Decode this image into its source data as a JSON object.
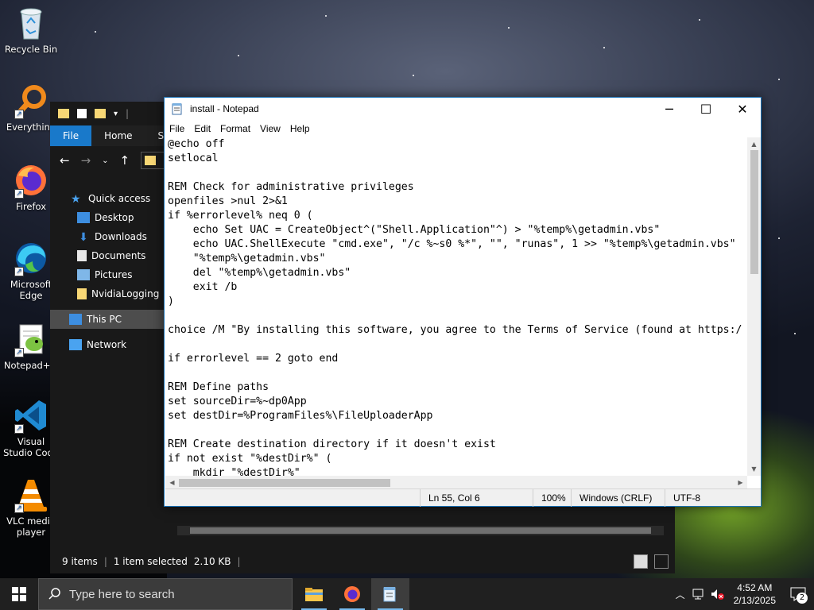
{
  "desktop": {
    "icons": [
      {
        "label": "Recycle Bin",
        "icon": "recycle-bin-icon"
      },
      {
        "label": "Everything",
        "icon": "everything-search-icon"
      },
      {
        "label": "Firefox",
        "icon": "firefox-icon"
      },
      {
        "label": "Microsoft Edge",
        "icon": "edge-icon"
      },
      {
        "label": "Notepad++",
        "icon": "notepadpp-icon"
      },
      {
        "label": "Visual Studio Code",
        "icon": "vscode-icon"
      },
      {
        "label": "VLC media player",
        "icon": "vlc-icon"
      }
    ]
  },
  "explorer": {
    "ribbon_tabs": [
      "File",
      "Home",
      "Sh"
    ],
    "sidebar": [
      {
        "label": "Quick access",
        "icon": "star-icon"
      },
      {
        "label": "Desktop",
        "icon": "desktop-folder-icon"
      },
      {
        "label": "Downloads",
        "icon": "download-icon"
      },
      {
        "label": "Documents",
        "icon": "documents-icon"
      },
      {
        "label": "Pictures",
        "icon": "pictures-icon"
      },
      {
        "label": "NvidiaLogging",
        "icon": "folder-icon"
      },
      {
        "label": "This PC",
        "icon": "pc-icon"
      },
      {
        "label": "Network",
        "icon": "network-icon"
      }
    ],
    "status": {
      "items": "9 items",
      "selected": "1 item selected",
      "size": "2.10 KB"
    }
  },
  "notepad": {
    "title": "install - Notepad",
    "menu": [
      "File",
      "Edit",
      "Format",
      "View",
      "Help"
    ],
    "content": "@echo off\nsetlocal\n\nREM Check for administrative privileges\nopenfiles >nul 2>&1\nif %errorlevel% neq 0 (\n    echo Set UAC = CreateObject^(\"Shell.Application\"^) > \"%temp%\\getadmin.vbs\"\n    echo UAC.ShellExecute \"cmd.exe\", \"/c %~s0 %*\", \"\", \"runas\", 1 >> \"%temp%\\getadmin.vbs\"\n    \"%temp%\\getadmin.vbs\"\n    del \"%temp%\\getadmin.vbs\"\n    exit /b\n)\n\nchoice /M \"By installing this software, you agree to the Terms of Service (found at https:/\n\nif errorlevel == 2 goto end\n\nREM Define paths\nset sourceDir=%~dp0App\nset destDir=%ProgramFiles%\\FileUploaderApp\n\nREM Create destination directory if it doesn't exist\nif not exist \"%destDir%\" (\n    mkdir \"%destDir%\"",
    "status": {
      "position": "Ln 55, Col 6",
      "zoom": "100%",
      "line_ending": "Windows (CRLF)",
      "encoding": "UTF-8"
    }
  },
  "taskbar": {
    "search_placeholder": "Type here to search",
    "apps": [
      "file-explorer-icon",
      "firefox-icon",
      "notepad-icon"
    ],
    "time": "4:52 AM",
    "date": "2/13/2025",
    "notifications": "2"
  }
}
